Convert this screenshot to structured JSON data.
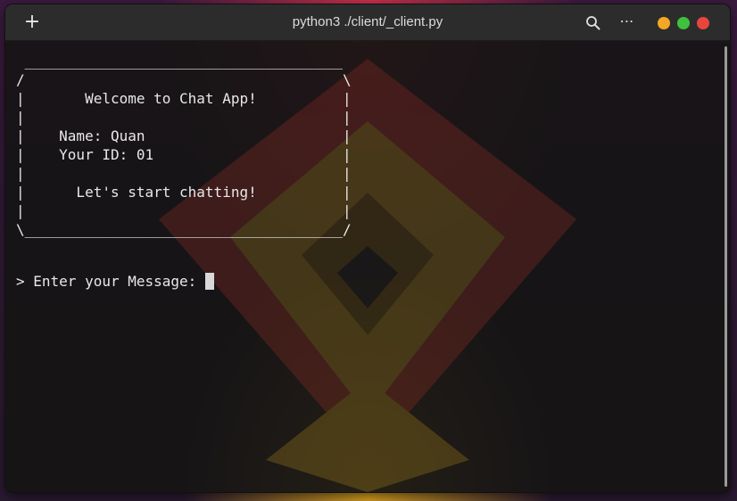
{
  "window": {
    "title": "python3 ./client/_client.py",
    "new_tab_icon": "plus-icon",
    "search_icon": "search-icon",
    "menu_icon": "more-horizontal-icon",
    "menu_glyph": "⋯",
    "new_tab_glyph": "+",
    "controls": {
      "minimize_color": "#f5a623",
      "maximize_color": "#3fc03f",
      "close_color": "#e8453c"
    }
  },
  "terminal": {
    "output": " _____________________________________\n/                                     \\\n|       Welcome to Chat App!          |\n|                                     |\n|    Name: Quan                       |\n|    Your ID: 01                      |\n|                                     |\n|      Let's start chatting!          |\n|                                     |\n\\_____________________________________/",
    "prompt": "> Enter your Message: "
  }
}
